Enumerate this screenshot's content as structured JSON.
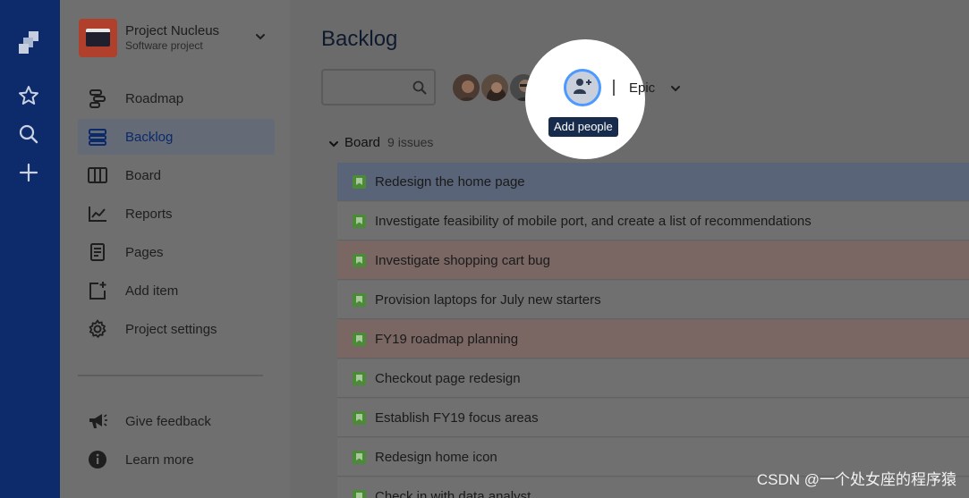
{
  "global_nav": {
    "icons": [
      "jira-logo-icon",
      "star-icon",
      "search-icon",
      "plus-icon"
    ]
  },
  "project": {
    "name": "Project Nucleus",
    "type": "Software project"
  },
  "sidebar": {
    "items": [
      {
        "label": "Roadmap",
        "icon": "roadmap-icon"
      },
      {
        "label": "Backlog",
        "icon": "backlog-icon",
        "selected": true
      },
      {
        "label": "Board",
        "icon": "board-icon"
      },
      {
        "label": "Reports",
        "icon": "reports-icon"
      },
      {
        "label": "Pages",
        "icon": "pages-icon"
      },
      {
        "label": "Add item",
        "icon": "add-item-icon"
      },
      {
        "label": "Project settings",
        "icon": "gear-icon"
      }
    ],
    "footer": [
      {
        "label": "Give feedback",
        "icon": "megaphone-icon"
      },
      {
        "label": "Learn more",
        "icon": "info-icon"
      }
    ]
  },
  "main": {
    "title": "Backlog",
    "search_placeholder": "",
    "add_people_tooltip": "Add people",
    "epic_filter": "Epic",
    "board": {
      "name": "Board",
      "count": "9 issues",
      "issues": [
        {
          "summary": "Redesign the home page",
          "state": "selected"
        },
        {
          "summary": "Investigate feasibility of mobile port, and create a list of recommendations",
          "state": "normal"
        },
        {
          "summary": "Investigate shopping cart bug",
          "state": "flagged"
        },
        {
          "summary": "Provision laptops for July new starters",
          "state": "normal"
        },
        {
          "summary": "FY19 roadmap planning",
          "state": "flagged"
        },
        {
          "summary": "Checkout page redesign",
          "state": "normal"
        },
        {
          "summary": "Establish FY19 focus areas",
          "state": "normal"
        },
        {
          "summary": "Redesign home icon",
          "state": "normal"
        },
        {
          "summary": "Check in with data analyst",
          "state": "normal"
        }
      ]
    }
  },
  "colors": {
    "global_nav": "#0d2a6b",
    "accent": "#4c9aff",
    "tooltip_bg": "#172b4d",
    "story": "#4b8a37"
  },
  "watermark": "CSDN @一个处女座的程序猿"
}
